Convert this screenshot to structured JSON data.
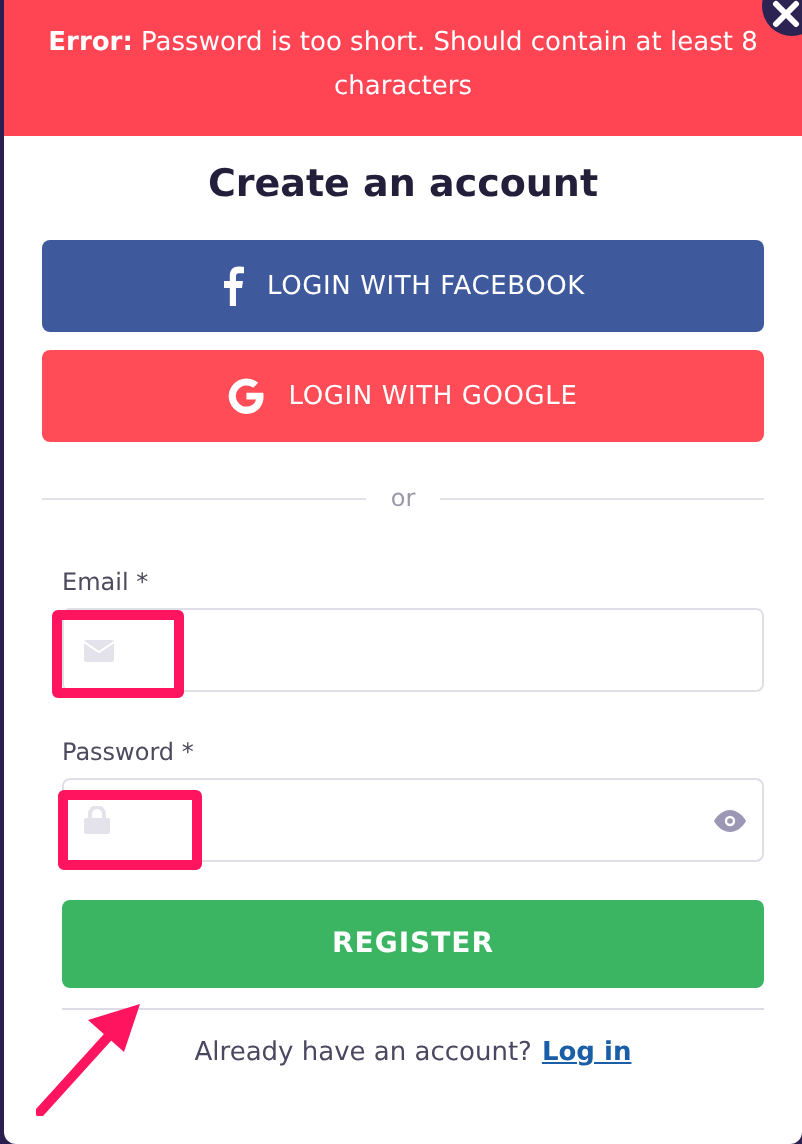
{
  "error_banner": {
    "label": "Error:",
    "message": "Password is too short. Should contain at least 8 characters"
  },
  "title": "Create an account",
  "social_buttons": [
    {
      "kind": "facebook",
      "label": "LOGIN WITH FACEBOOK"
    },
    {
      "kind": "google",
      "label": "LOGIN WITH GOOGLE"
    }
  ],
  "divider": "or",
  "fields": [
    {
      "kind": "email",
      "label": "Email *",
      "highlighted": true
    },
    {
      "kind": "password",
      "label": "Password *",
      "highlighted": true
    }
  ],
  "register": {
    "label": "REGISTER",
    "pointed": true
  },
  "footer": {
    "text": "Already have an account?",
    "link": "Log in"
  }
}
